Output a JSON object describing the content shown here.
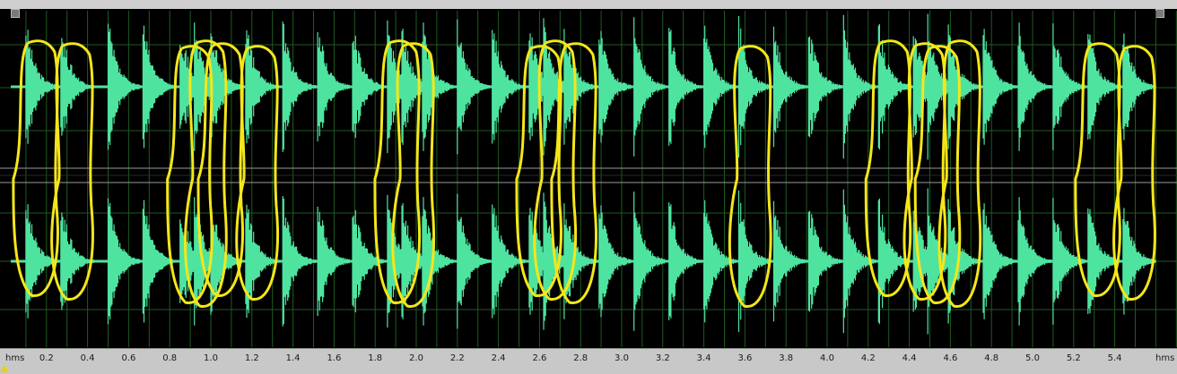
{
  "timeline": {
    "unit_left": "hms",
    "unit_right": "hms",
    "tick_labels": [
      "0.2",
      "0.4",
      "0.6",
      "0.8",
      "1.0",
      "1.2",
      "1.4",
      "1.6",
      "1.8",
      "2.0",
      "2.2",
      "2.4",
      "2.6",
      "2.8",
      "3.0",
      "3.2",
      "3.4",
      "3.6",
      "3.8",
      "4.0",
      "4.2",
      "4.4",
      "4.6",
      "4.8",
      "5.0",
      "5.2",
      "5.4"
    ],
    "tick_values": [
      0.2,
      0.4,
      0.6,
      0.8,
      1.0,
      1.2,
      1.4,
      1.6,
      1.8,
      2.0,
      2.2,
      2.4,
      2.6,
      2.8,
      3.0,
      3.2,
      3.4,
      3.6,
      3.8,
      4.0,
      4.2,
      4.4,
      4.6,
      4.8,
      5.0,
      5.2,
      5.4
    ]
  },
  "waveform": {
    "color": "#4fe3a0",
    "background": "#000000",
    "grid_color": "#1f5a1f",
    "channels": [
      "top",
      "bottom"
    ],
    "onset_times_s": [
      0.1,
      0.27,
      0.5,
      0.67,
      0.85,
      0.92,
      1.0,
      1.17,
      1.35,
      1.52,
      1.69,
      1.86,
      1.93,
      2.03,
      2.2,
      2.37,
      2.55,
      2.62,
      2.72,
      2.89,
      3.06,
      3.23,
      3.4,
      3.57,
      3.74,
      3.91,
      4.08,
      4.25,
      4.42,
      4.49,
      4.59,
      4.76,
      4.93,
      5.1,
      5.27,
      5.44
    ]
  },
  "annotations": {
    "color": "#f5e61a",
    "highlighted_onsets_s": [
      0.1,
      0.27,
      0.85,
      0.92,
      1.0,
      1.17,
      1.86,
      1.93,
      2.55,
      2.62,
      2.72,
      3.57,
      4.25,
      4.42,
      4.49,
      4.59,
      5.27,
      5.44
    ]
  }
}
